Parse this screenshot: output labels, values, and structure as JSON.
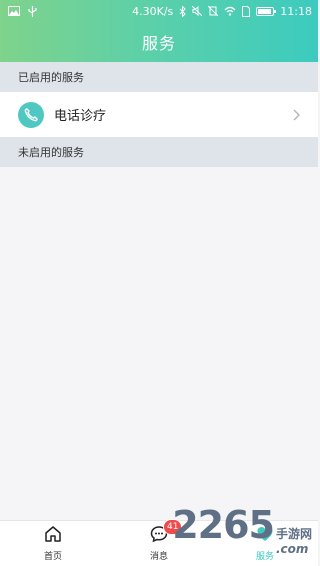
{
  "status_bar": {
    "net_speed": "4.30K/s",
    "time": "11:18",
    "icons": [
      "image-icon",
      "usb-icon",
      "bluetooth-icon",
      "mute-icon",
      "no-sim-icon",
      "wifi-icon",
      "sim-icon",
      "battery-icon"
    ]
  },
  "header": {
    "title": "服务"
  },
  "sections": {
    "enabled_title": "已启用的服务",
    "disabled_title": "未启用的服务"
  },
  "services": {
    "enabled": [
      {
        "label": "电话诊疗",
        "icon": "phone-icon"
      }
    ]
  },
  "tabbar": {
    "tabs": [
      {
        "label": "首页",
        "icon": "home-icon"
      },
      {
        "label": "消息",
        "icon": "chat-icon",
        "badge": "41"
      },
      {
        "label": "服务",
        "icon": "service-icon",
        "active": true
      }
    ]
  },
  "watermark": {
    "number": "2265",
    "site_cn": "手游网",
    "site_en": ".com"
  },
  "colors": {
    "accent": "#3ccbbf",
    "badge": "#f04a4a"
  }
}
